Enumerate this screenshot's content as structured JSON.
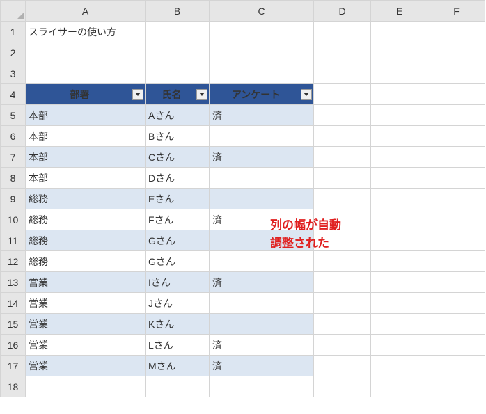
{
  "columns": [
    "A",
    "B",
    "C",
    "D",
    "E",
    "F"
  ],
  "row_count": 18,
  "cells": {
    "A1": "スライサーの使い方"
  },
  "table": {
    "header_row": 4,
    "headers": [
      "部署",
      "氏名",
      "アンケート"
    ],
    "rows": [
      {
        "r": 5,
        "dept": "本部",
        "name": "Aさん",
        "survey": "済"
      },
      {
        "r": 6,
        "dept": "本部",
        "name": "Bさん",
        "survey": ""
      },
      {
        "r": 7,
        "dept": "本部",
        "name": "Cさん",
        "survey": "済"
      },
      {
        "r": 8,
        "dept": "本部",
        "name": "Dさん",
        "survey": ""
      },
      {
        "r": 9,
        "dept": "総務",
        "name": "Eさん",
        "survey": ""
      },
      {
        "r": 10,
        "dept": "総務",
        "name": "Fさん",
        "survey": "済"
      },
      {
        "r": 11,
        "dept": "総務",
        "name": "Gさん",
        "survey": ""
      },
      {
        "r": 12,
        "dept": "総務",
        "name": "Gさん",
        "survey": ""
      },
      {
        "r": 13,
        "dept": "営業",
        "name": "Iさん",
        "survey": "済"
      },
      {
        "r": 14,
        "dept": "営業",
        "name": "Jさん",
        "survey": ""
      },
      {
        "r": 15,
        "dept": "営業",
        "name": "Kさん",
        "survey": ""
      },
      {
        "r": 16,
        "dept": "営業",
        "name": "Lさん",
        "survey": "済"
      },
      {
        "r": 17,
        "dept": "営業",
        "name": "Mさん",
        "survey": "済"
      }
    ]
  },
  "annotation": "列の幅が自動\n調整された"
}
